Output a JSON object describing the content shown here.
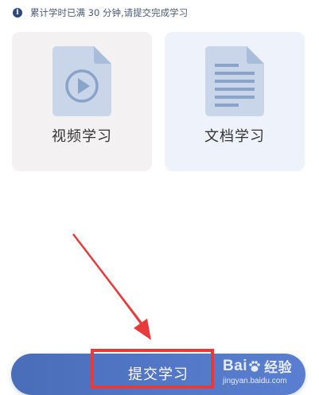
{
  "notice": {
    "icon": "info-icon",
    "text": "累计学时已满 30 分钟,请提交完成学习"
  },
  "cards": {
    "video": {
      "icon": "video-file-icon",
      "label": "视频学习",
      "background": "#f3f1f2"
    },
    "document": {
      "icon": "document-file-icon",
      "label": "文档学习",
      "background": "#eef3fb"
    }
  },
  "submit": {
    "label": "提交学习",
    "color": "#5277c6"
  },
  "annotation": {
    "color": "#e83a3a"
  },
  "watermark": {
    "brand_left": "Bai",
    "brand_right": "经验",
    "url": "jingyan.baidu.com"
  },
  "colors": {
    "icon_fill": "#c9d6ea",
    "icon_fold": "#a9bcd9",
    "icon_stroke": "#8aa3c8"
  }
}
